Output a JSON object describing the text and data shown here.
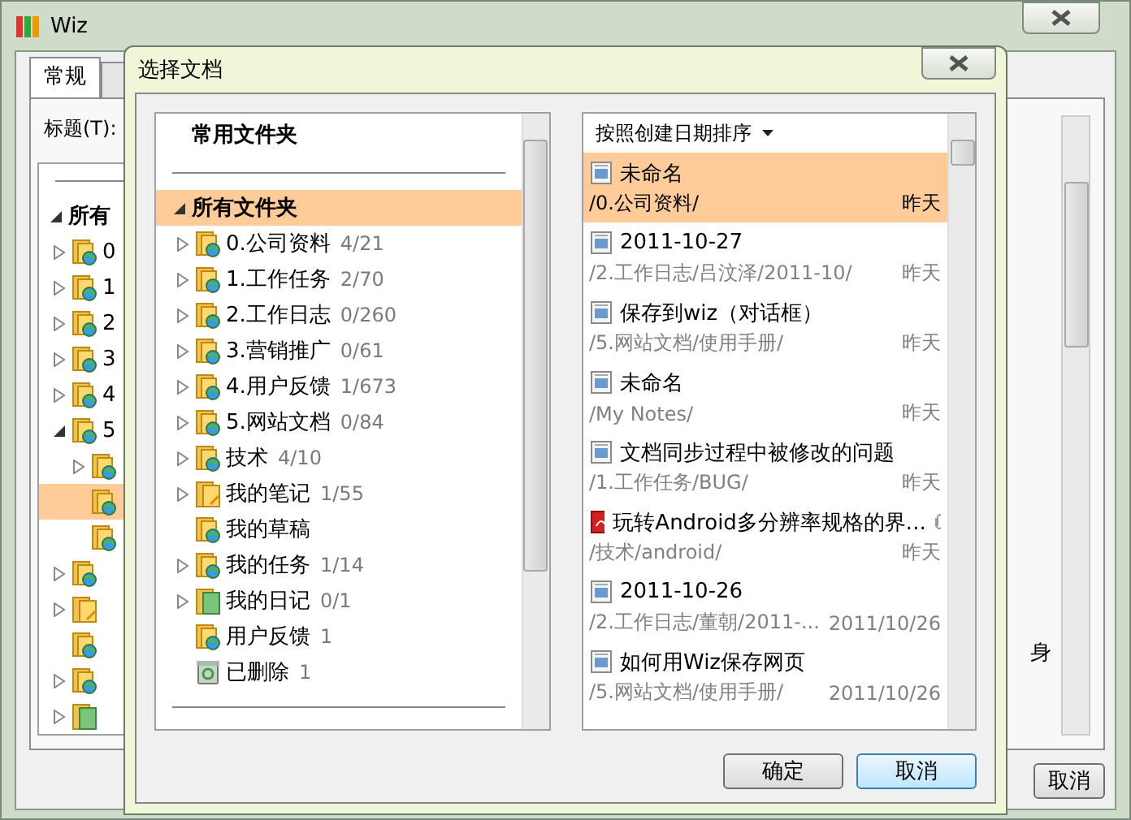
{
  "background_window": {
    "title": "Wiz",
    "tabs": [
      {
        "label": "常规",
        "selected": true
      },
      {
        "selected": false
      }
    ],
    "title_label": "标题(T):",
    "tree": {
      "label": "所有",
      "expanded": true,
      "children": [
        {
          "label": "0",
          "kind": "web",
          "expanded": false
        },
        {
          "label": "1",
          "kind": "web",
          "expanded": false
        },
        {
          "label": "2",
          "kind": "web",
          "expanded": false
        },
        {
          "label": "3",
          "kind": "web",
          "expanded": false
        },
        {
          "label": "4",
          "kind": "web",
          "expanded": false
        },
        {
          "label": "5",
          "kind": "web",
          "expanded": true,
          "children": [
            {
              "expanded": false,
              "selected": false
            },
            {
              "selected": true
            },
            {
              "selected": false
            }
          ]
        },
        {
          "kind": "web",
          "expanded": false
        },
        {
          "kind": "note",
          "expanded": false
        },
        {
          "kind": "web"
        },
        {
          "kind": "web",
          "expanded": false
        },
        {
          "kind": "diary",
          "expanded": false
        }
      ]
    },
    "side_text": "身",
    "buttons": [
      "取消"
    ]
  },
  "dialog": {
    "title": "选择文档",
    "folders": {
      "header": "常用文件夹",
      "root": {
        "label": "所有文件夹",
        "selected": true,
        "expanded": true,
        "children": [
          {
            "label": "0.公司资料",
            "count": "4/21",
            "kind": "web",
            "expanded": false
          },
          {
            "label": "1.工作任务",
            "count": "2/70",
            "kind": "web",
            "expanded": false
          },
          {
            "label": "2.工作日志",
            "count": "0/260",
            "kind": "web",
            "expanded": false
          },
          {
            "label": "3.营销推广",
            "count": "0/61",
            "kind": "web",
            "expanded": false
          },
          {
            "label": "4.用户反馈",
            "count": "1/673",
            "kind": "web",
            "expanded": false
          },
          {
            "label": "5.网站文档",
            "count": "0/84",
            "kind": "web",
            "expanded": false
          },
          {
            "label": "技术",
            "count": "4/10",
            "kind": "web",
            "expanded": false
          },
          {
            "label": "我的笔记",
            "count": "1/55",
            "kind": "note",
            "expanded": false
          },
          {
            "label": "我的草稿",
            "kind": "web"
          },
          {
            "label": "我的任务",
            "count": "1/14",
            "kind": "web",
            "expanded": false
          },
          {
            "label": "我的日记",
            "count": "0/1",
            "kind": "diary",
            "expanded": false
          },
          {
            "label": "用户反馈",
            "count": "1",
            "kind": "web"
          },
          {
            "label": "已删除",
            "count": "1",
            "kind": "trash"
          }
        ]
      }
    },
    "documents": {
      "sort": "按照创建日期排序",
      "items": [
        {
          "title": "未命名",
          "path": "/0.公司资料/",
          "date": "昨天",
          "kind": "note",
          "attachment": false,
          "selected": true
        },
        {
          "title": "2011-10-27",
          "path": "/2.工作日志/吕汶泽/2011-10/",
          "date": "昨天",
          "kind": "note",
          "attachment": false,
          "selected": false
        },
        {
          "title": "保存到wiz（对话框）",
          "path": "/5.网站文档/使用手册/",
          "date": "昨天",
          "kind": "note",
          "attachment": false,
          "selected": false
        },
        {
          "title": "未命名",
          "path": "/My Notes/",
          "date": "昨天",
          "kind": "note",
          "attachment": false,
          "selected": false
        },
        {
          "title": "文档同步过程中被修改的问题",
          "path": "/1.工作任务/BUG/",
          "date": "昨天",
          "kind": "note",
          "attachment": false,
          "selected": false
        },
        {
          "title": "玩转Android多分辨率规格的界...",
          "path": "/技术/android/",
          "date": "昨天",
          "kind": "pdf",
          "attachment": true,
          "selected": false
        },
        {
          "title": "2011-10-26",
          "path": "/2.工作日志/董朝/2011-...",
          "date": "2011/10/26",
          "kind": "note",
          "attachment": false,
          "selected": false
        },
        {
          "title": "如何用Wiz保存网页",
          "path": "/5.网站文档/使用手册/",
          "date": "2011/10/26",
          "kind": "note",
          "attachment": false,
          "selected": false
        }
      ]
    },
    "buttons": [
      "确定",
      "取消"
    ]
  }
}
